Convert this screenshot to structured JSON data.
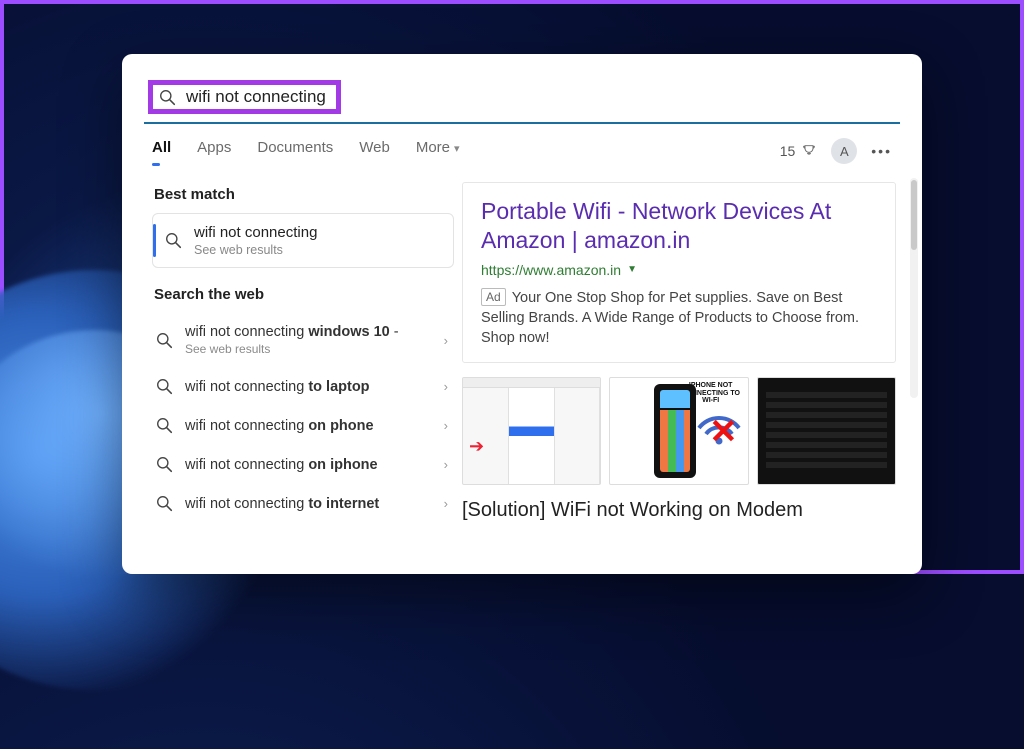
{
  "search": {
    "query": "wifi not connecting"
  },
  "tabs": {
    "all": "All",
    "apps": "Apps",
    "documents": "Documents",
    "web": "Web",
    "more": "More"
  },
  "header": {
    "rewards_points": "15",
    "avatar_initial": "A"
  },
  "sections": {
    "best_match": "Best match",
    "search_web": "Search the web"
  },
  "best": {
    "title": "wifi not connecting",
    "sub": "See web results"
  },
  "web_items": [
    {
      "prefix": "wifi not connecting ",
      "bold": "windows 10",
      "suffix": " -",
      "sub": "See web results"
    },
    {
      "prefix": "wifi not connecting ",
      "bold": "to laptop",
      "suffix": "",
      "sub": ""
    },
    {
      "prefix": "wifi not connecting ",
      "bold": "on phone",
      "suffix": "",
      "sub": ""
    },
    {
      "prefix": "wifi not connecting ",
      "bold": "on iphone",
      "suffix": "",
      "sub": ""
    },
    {
      "prefix": "wifi not connecting ",
      "bold": "to internet",
      "suffix": "",
      "sub": ""
    }
  ],
  "ad": {
    "title": "Portable Wifi - Network Devices At Amazon | amazon.in",
    "url": "https://www.amazon.in",
    "chip": "Ad",
    "body": "Your One Stop Shop for Pet supplies. Save on Best Selling Brands. A Wide Range of Products to Choose from. Shop now!"
  },
  "thumb_caption": "IPHONE NOT CONNECTING TO WI-FI",
  "result2_title": "[Solution] WiFi not Working on Modem"
}
